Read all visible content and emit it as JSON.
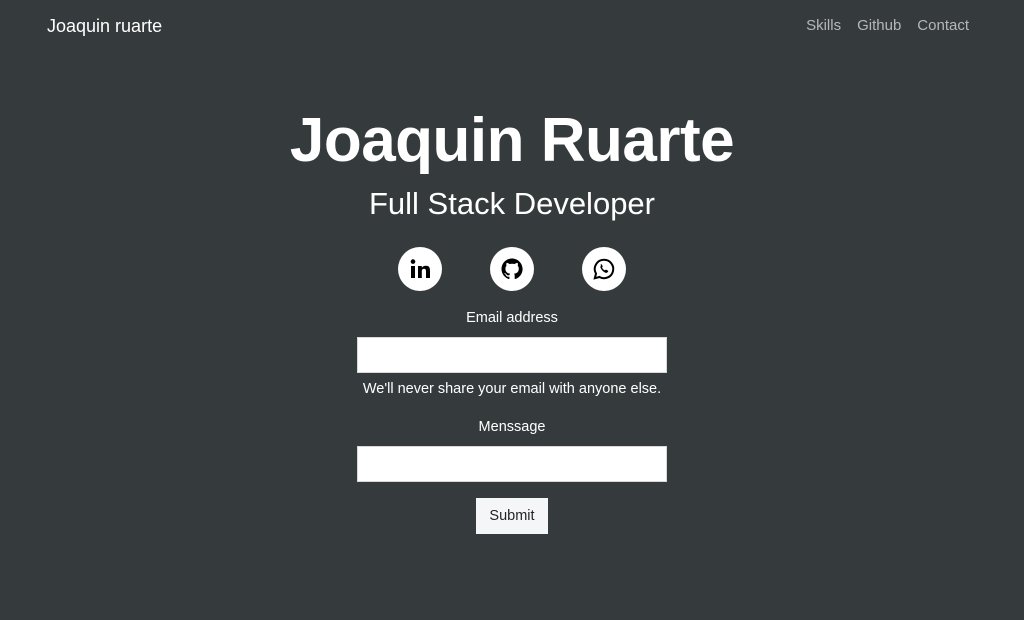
{
  "navbar": {
    "brand": "Joaquin ruarte",
    "links": [
      {
        "label": "Skills"
      },
      {
        "label": "Github"
      },
      {
        "label": "Contact"
      }
    ]
  },
  "hero": {
    "name": "Joaquin Ruarte",
    "role": "Full Stack Developer"
  },
  "socials": [
    {
      "icon": "linkedin-icon"
    },
    {
      "icon": "github-icon"
    },
    {
      "icon": "whatsapp-icon"
    }
  ],
  "form": {
    "email_label": "Email address",
    "email_value": "",
    "email_placeholder": "",
    "email_help": "We'll never share your email with anyone else.",
    "message_label": "Menssage",
    "message_value": "",
    "message_placeholder": "",
    "submit_label": "Submit"
  },
  "colors": {
    "background": "#353a3d",
    "text": "#ffffff",
    "nav_link": "#b5b8ba",
    "button_bg": "#f5f6f7"
  }
}
